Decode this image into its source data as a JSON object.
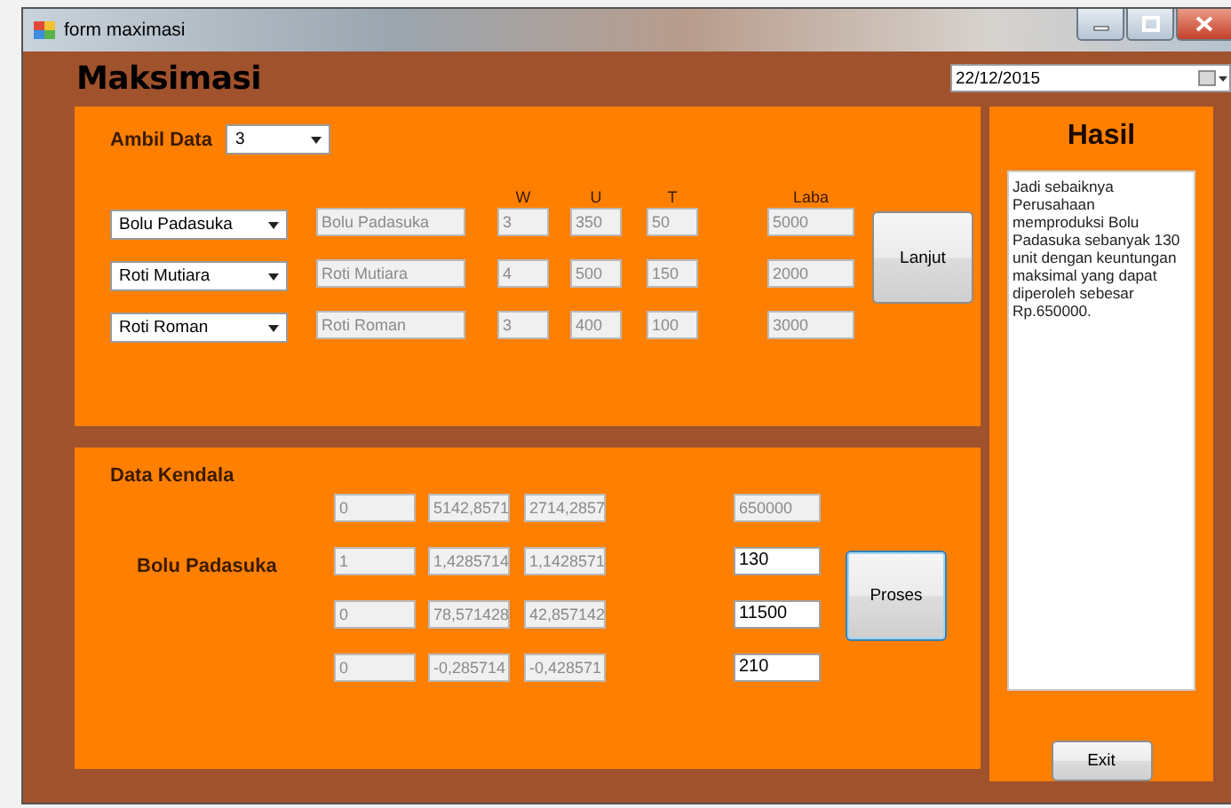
{
  "window": {
    "title": "form maximasi"
  },
  "header": {
    "title": "Maksimasi",
    "date": "22/12/2015"
  },
  "ambil_data": {
    "label": "Ambil Data",
    "value": "3"
  },
  "product_columns": [
    "W",
    "U",
    "T",
    "Laba"
  ],
  "products": [
    {
      "choice": "Bolu Padasuka",
      "name": "Bolu Padasuka",
      "w": "3",
      "u": "350",
      "t": "50",
      "laba": "5000"
    },
    {
      "choice": "Roti Mutiara",
      "name": "Roti Mutiara",
      "w": "4",
      "u": "500",
      "t": "150",
      "laba": "2000"
    },
    {
      "choice": "Roti Roman",
      "name": "Roti Roman",
      "w": "3",
      "u": "400",
      "t": "100",
      "laba": "3000"
    }
  ],
  "lanjut_button": "Lanjut",
  "data_kendala": {
    "title": "Data Kendala",
    "product": "Bolu Padasuka",
    "rows": [
      {
        "column_1": "0",
        "column_2": "5142,8571",
        "column_3": "2714,2857",
        "result": "650000",
        "readonly": true
      },
      {
        "column_1": "1",
        "column_2": "1,4285714",
        "column_3": "1,1428571",
        "result": "130",
        "readonly": false
      },
      {
        "column_1": "0",
        "column_2": "78,571428",
        "column_3": "42,857142",
        "result": "11500",
        "readonly": false
      },
      {
        "column_1": "0",
        "column_2": "-0,285714",
        "column_3": "-0,428571",
        "result": "210",
        "readonly": false
      }
    ]
  },
  "proses_button": "Proses",
  "hasil": {
    "title": "Hasil",
    "text": "Jadi sebaiknya Perusahaan memproduksi Bolu Padasuka sebanyak 130 unit dengan keuntungan maksimal yang dapat diperoleh sebesar Rp.650000."
  },
  "exit_button": "Exit"
}
